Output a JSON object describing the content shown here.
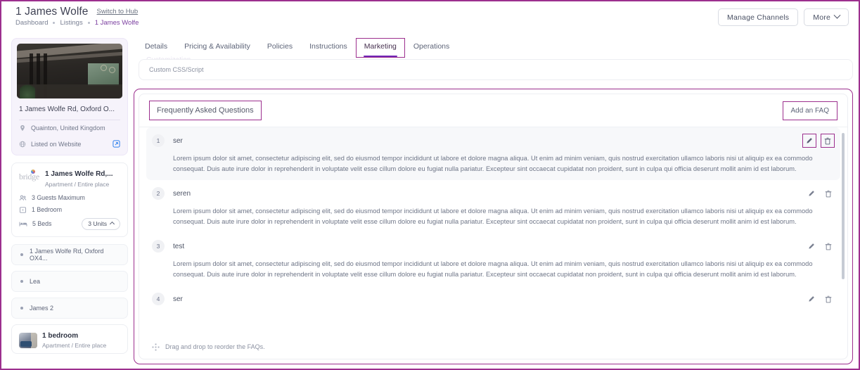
{
  "header": {
    "title": "1 James Wolfe",
    "switch_link": "Switch to Hub",
    "breadcrumb": [
      "Dashboard",
      "Listings",
      "1 James Wolfe"
    ],
    "manage_channels_label": "Manage Channels",
    "more_label": "More"
  },
  "sidebar": {
    "property": {
      "address": "1 James Wolfe Rd, Oxford O...",
      "location": "Quainton, United Kingdom",
      "listing_status": "Listed on Website"
    },
    "listing": {
      "brand": "bridge",
      "title": "1 James Wolfe Rd,...",
      "subtitle": "Apartment / Entire place",
      "specs": [
        "3 Guests Maximum",
        "1 Bedroom",
        "5 Beds"
      ],
      "units_label": "3 Units"
    },
    "units": [
      {
        "label": "1 James Wolfe Rd, Oxford OX4..."
      },
      {
        "label": "Lea"
      },
      {
        "label": "James 2"
      }
    ],
    "other_listing": {
      "title": "1 bedroom",
      "subtitle": "Apartment / Entire place"
    }
  },
  "main": {
    "tabs": [
      {
        "label": "Details",
        "active": false
      },
      {
        "label": "Pricing & Availability",
        "active": false
      },
      {
        "label": "Policies",
        "active": false
      },
      {
        "label": "Instructions",
        "active": false
      },
      {
        "label": "Marketing",
        "active": true
      },
      {
        "label": "Operations",
        "active": false
      }
    ],
    "ghost_label": "Customization",
    "custom_css_label": "Custom CSS/Script",
    "faq": {
      "section_title": "Frequently Asked Questions",
      "add_button": "Add an FAQ",
      "reorder_hint": "Drag and drop to reorder the FAQs.",
      "body_text": "Lorem ipsum dolor sit amet, consectetur adipiscing elit, sed do eiusmod tempor incididunt ut labore et dolore magna aliqua. Ut enim ad minim veniam, quis nostrud exercitation ullamco laboris nisi ut aliquip ex ea commodo consequat. Duis aute irure dolor in reprehenderit in voluptate velit esse cillum dolore eu fugiat nulla pariatur. Excepteur sint occaecat cupidatat non proident, sunt in culpa qui officia deserunt mollit anim id est laborum.",
      "items": [
        {
          "num": "1",
          "question": "ser",
          "highlighted": true
        },
        {
          "num": "2",
          "question": "seren",
          "highlighted": false
        },
        {
          "num": "3",
          "question": "test",
          "highlighted": false
        },
        {
          "num": "4",
          "question": "ser",
          "highlighted": false
        }
      ]
    }
  },
  "colors": {
    "accent_purple": "#7126b5",
    "highlight_magenta": "#9c2f8e",
    "link_blue": "#2f80ed",
    "text_muted": "#8b91a1"
  }
}
